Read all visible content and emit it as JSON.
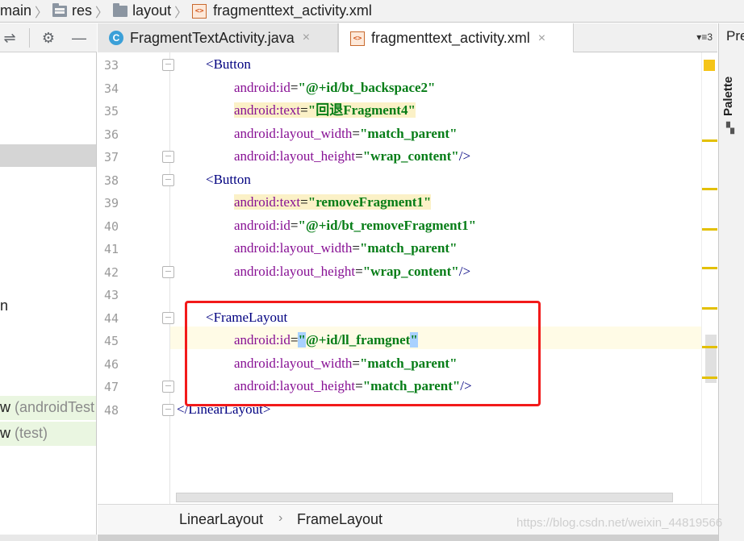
{
  "breadcrumb": {
    "items": [
      {
        "label": "main",
        "icon": "folder-icon"
      },
      {
        "label": "res",
        "icon": "resources-folder-icon"
      },
      {
        "label": "layout",
        "icon": "folder-icon"
      },
      {
        "label": "fragmenttext_activity.xml",
        "icon": "xml-file-icon"
      }
    ]
  },
  "toolbar": {
    "icons": [
      "collapse-icon",
      "gear-icon",
      "minimize-icon"
    ]
  },
  "project_panel": {
    "partial_items": [
      "n",
      "w (androidTest",
      "w (test)"
    ],
    "partial_items_paren": [
      "(androidTest",
      "(test)"
    ]
  },
  "tabs": [
    {
      "label": "FragmentTextActivity.java",
      "icon": "java-class-icon",
      "active": false,
      "close": "×"
    },
    {
      "label": "fragmenttext_activity.xml",
      "icon": "xml-file-icon",
      "active": true,
      "close": "×"
    }
  ],
  "tab_overflow": "▾≡3",
  "right_panel": {
    "pre_label": "Pre",
    "palette_label": "Palette"
  },
  "code": {
    "lines": [
      {
        "num": "33",
        "indent": 2,
        "tag_open": "<",
        "tag": "Button",
        "tag_close": ""
      },
      {
        "num": "34",
        "indent": 3,
        "attr": "android:id",
        "value": "\"@+id/bt_backspace2\"",
        "end": ""
      },
      {
        "num": "35",
        "indent": 3,
        "attr": "android:text",
        "value": "\"回退Fragment4\"",
        "end": "",
        "highlight": true
      },
      {
        "num": "36",
        "indent": 3,
        "attr": "android:layout_width",
        "value": "\"match_parent\"",
        "end": ""
      },
      {
        "num": "37",
        "indent": 3,
        "attr": "android:layout_height",
        "value": "\"wrap_content\"",
        "end": "/>"
      },
      {
        "num": "38",
        "indent": 2,
        "tag_open": "<",
        "tag": "Button",
        "tag_close": ""
      },
      {
        "num": "39",
        "indent": 3,
        "attr": "android:text",
        "value": "\"removeFragment1\"",
        "end": "",
        "highlight": true
      },
      {
        "num": "40",
        "indent": 3,
        "attr": "android:id",
        "value": "\"@+id/bt_removeFragment1\"",
        "end": ""
      },
      {
        "num": "41",
        "indent": 3,
        "attr": "android:layout_width",
        "value": "\"match_parent\"",
        "end": ""
      },
      {
        "num": "42",
        "indent": 3,
        "attr": "android:layout_height",
        "value": "\"wrap_content\"",
        "end": "/>"
      },
      {
        "num": "43",
        "indent": 0,
        "blank": true
      },
      {
        "num": "44",
        "indent": 2,
        "tag_open": "<",
        "tag": "FrameLayout",
        "tag_close": ""
      },
      {
        "num": "45",
        "indent": 3,
        "attr": "android:id",
        "value": "\"@+id/ll_framgnet\"",
        "end": "",
        "current": true
      },
      {
        "num": "46",
        "indent": 3,
        "attr": "android:layout_width",
        "value": "\"match_parent\"",
        "end": ""
      },
      {
        "num": "47",
        "indent": 3,
        "attr": "android:layout_height",
        "value": "\"match_parent\"",
        "end": "/>"
      },
      {
        "num": "48",
        "indent": 0,
        "tag_open": "</",
        "tag": "LinearLayout",
        "tag_close": ">"
      }
    ]
  },
  "bottom_breadcrumb": {
    "items": [
      "LinearLayout",
      "FrameLayout"
    ],
    "separator": "›"
  },
  "watermark": "https://blog.csdn.net/weixin_44819566",
  "colors": {
    "tag": "#000080",
    "attribute": "#871094",
    "string": "#067d17",
    "highlight_box": "#f21a1a",
    "warning_stripe": "#e3c000"
  }
}
